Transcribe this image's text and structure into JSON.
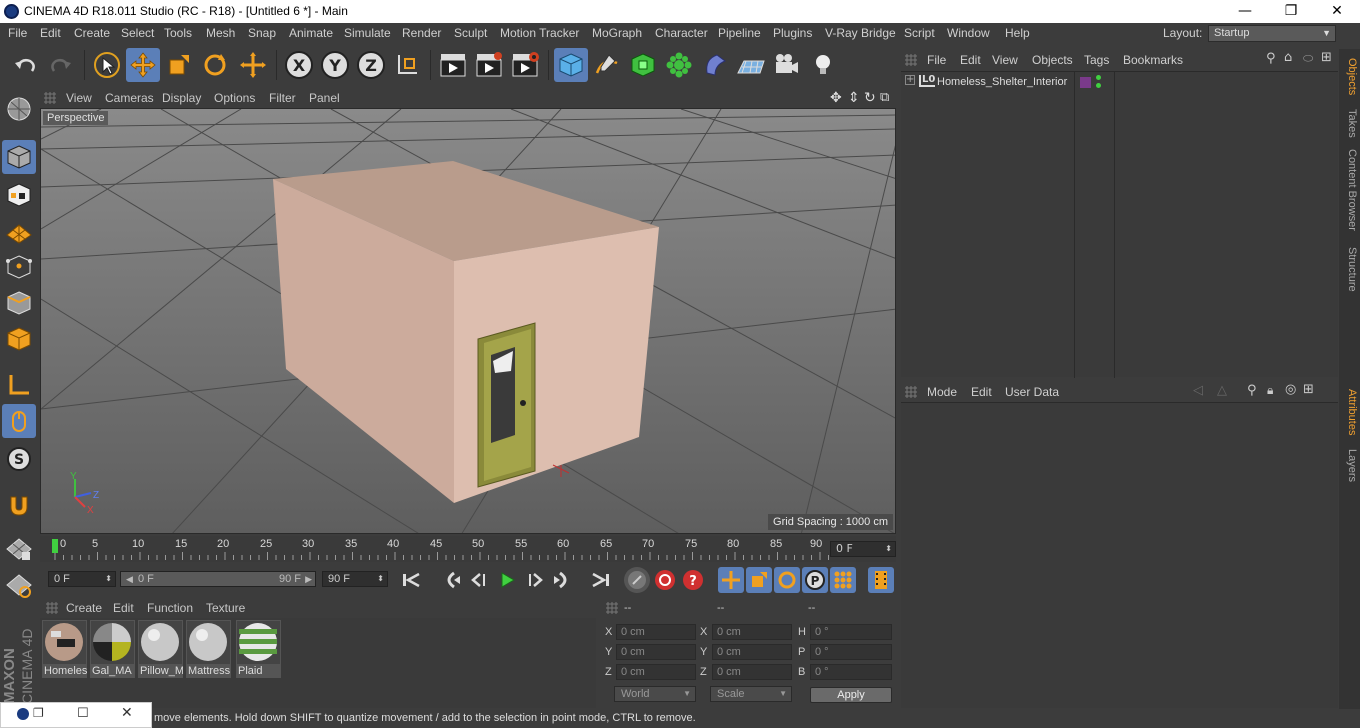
{
  "titlebar": {
    "title": "CINEMA 4D R18.011 Studio (RC - R18) - [Untitled 6 *] - Main",
    "minimize": "—",
    "maximize": "❐",
    "close": "✕"
  },
  "menu": {
    "items": [
      "File",
      "Edit",
      "Create",
      "Select",
      "Tools",
      "Mesh",
      "Snap",
      "Animate",
      "Simulate",
      "Render",
      "Sculpt",
      "Motion Tracker",
      "MoGraph",
      "Character",
      "Pipeline",
      "Plugins",
      "V-Ray Bridge",
      "Script",
      "Window",
      "Help"
    ],
    "layout_label": "Layout:",
    "layout_value": "Startup"
  },
  "viewport": {
    "menu": [
      "View",
      "Cameras",
      "Display",
      "Options",
      "Filter",
      "Panel"
    ],
    "camera_label": "Perspective",
    "grid_spacing": "Grid Spacing : 1000 cm",
    "axis_y": "Y",
    "axis_z": "Z",
    "axis_x": "X"
  },
  "timeline": {
    "ticks": [
      "0",
      "5",
      "10",
      "15",
      "20",
      "25",
      "30",
      "35",
      "40",
      "45",
      "50",
      "55",
      "60",
      "65",
      "70",
      "75",
      "80",
      "85",
      "90"
    ],
    "current_frame": "0 F"
  },
  "transport": {
    "start_field": "0 F",
    "range_start": "0 F",
    "range_end": "90 F",
    "end_field": "90 F"
  },
  "materials": {
    "menu": [
      "Create",
      "Edit",
      "Function",
      "Texture"
    ],
    "items": [
      "Homeles",
      "Gal_MA",
      "Pillow_M",
      "Mattress",
      "Plaid"
    ]
  },
  "coordinates": {
    "col_headers": [
      "--",
      "--",
      "--"
    ],
    "rows": [
      {
        "l1": "X",
        "v1": "0 cm",
        "l2": "X",
        "v2": "0 cm",
        "l3": "H",
        "v3": "0 °"
      },
      {
        "l1": "Y",
        "v1": "0 cm",
        "l2": "Y",
        "v2": "0 cm",
        "l3": "P",
        "v3": "0 °"
      },
      {
        "l1": "Z",
        "v1": "0 cm",
        "l2": "Z",
        "v2": "0 cm",
        "l3": "B",
        "v3": "0 °"
      }
    ],
    "space": "World",
    "mode": "Scale",
    "apply": "Apply"
  },
  "status": {
    "text": "move elements. Hold down SHIFT to quantize movement / add to the selection in point mode, CTRL to remove."
  },
  "objects": {
    "menu": [
      "File",
      "Edit",
      "View",
      "Objects",
      "Tags",
      "Bookmarks"
    ],
    "item_name": "Homeless_Shelter_Interior",
    "layer_badge": "L0"
  },
  "attributes": {
    "menu": [
      "Mode",
      "Edit",
      "User Data"
    ]
  },
  "side_tabs": [
    "Objects",
    "Takes",
    "Content Browser",
    "Structure",
    "Attributes",
    "Layers"
  ],
  "brand": {
    "maxon": "MAXON",
    "product": "CINEMA 4D"
  }
}
